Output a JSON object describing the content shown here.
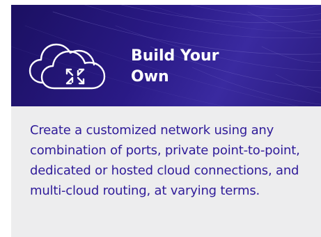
{
  "card": {
    "title": "Build Your\nOwn",
    "description": "Create a customized network using any combination of ports, private point-to-point, dedicated or hosted cloud connections, and multi-cloud routing, at varying terms.",
    "icon": "cloud-arrows-icon"
  },
  "colors": {
    "banner_background": "#2a1a86",
    "card_background": "#ededee",
    "text_accent": "#2f1b99",
    "title_text": "#ffffff"
  }
}
